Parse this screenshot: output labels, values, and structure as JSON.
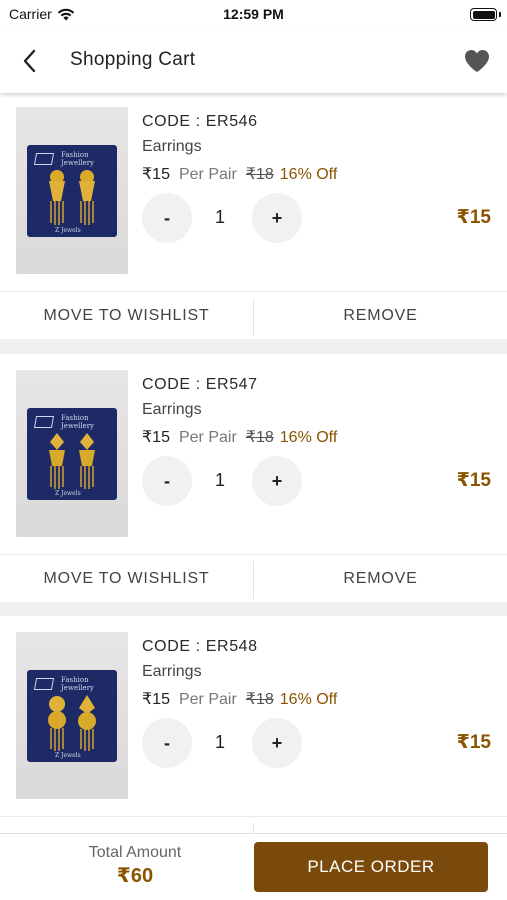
{
  "status_bar": {
    "carrier": "Carrier",
    "time": "12:59 PM"
  },
  "header": {
    "title": "Shopping Cart"
  },
  "cart_items": [
    {
      "code": "CODE : ER546",
      "category": "Earrings",
      "price": "₹15",
      "unit": "Per Pair",
      "mrp": "₹18",
      "discount": "16% Off",
      "quantity": "1",
      "line_total": "₹15",
      "brand": "Fashion Jewellery",
      "footer": "Z Jewels"
    },
    {
      "code": "CODE : ER547",
      "category": "Earrings",
      "price": "₹15",
      "unit": "Per Pair",
      "mrp": "₹18",
      "discount": "16% Off",
      "quantity": "1",
      "line_total": "₹15",
      "brand": "Fashion Jewellery",
      "footer": "Z Jewels"
    },
    {
      "code": "CODE : ER548",
      "category": "Earrings",
      "price": "₹15",
      "unit": "Per Pair",
      "mrp": "₹18",
      "discount": "16% Off",
      "quantity": "1",
      "line_total": "₹15",
      "brand": "Fashion Jewellery",
      "footer": "Z Jewels"
    }
  ],
  "actions": {
    "wishlist": "MOVE TO WISHLIST",
    "remove": "REMOVE",
    "decrement": "-",
    "increment": "+"
  },
  "footer": {
    "total_label": "Total Amount",
    "total_value": "₹60",
    "place_order": "PLACE ORDER"
  },
  "colors": {
    "accent": "#8a5300",
    "button": "#7a4a0c"
  },
  "icons": {
    "back": "chevron-left-icon",
    "wishlist": "heart-icon",
    "wifi": "wifi-icon",
    "battery": "battery-icon"
  }
}
